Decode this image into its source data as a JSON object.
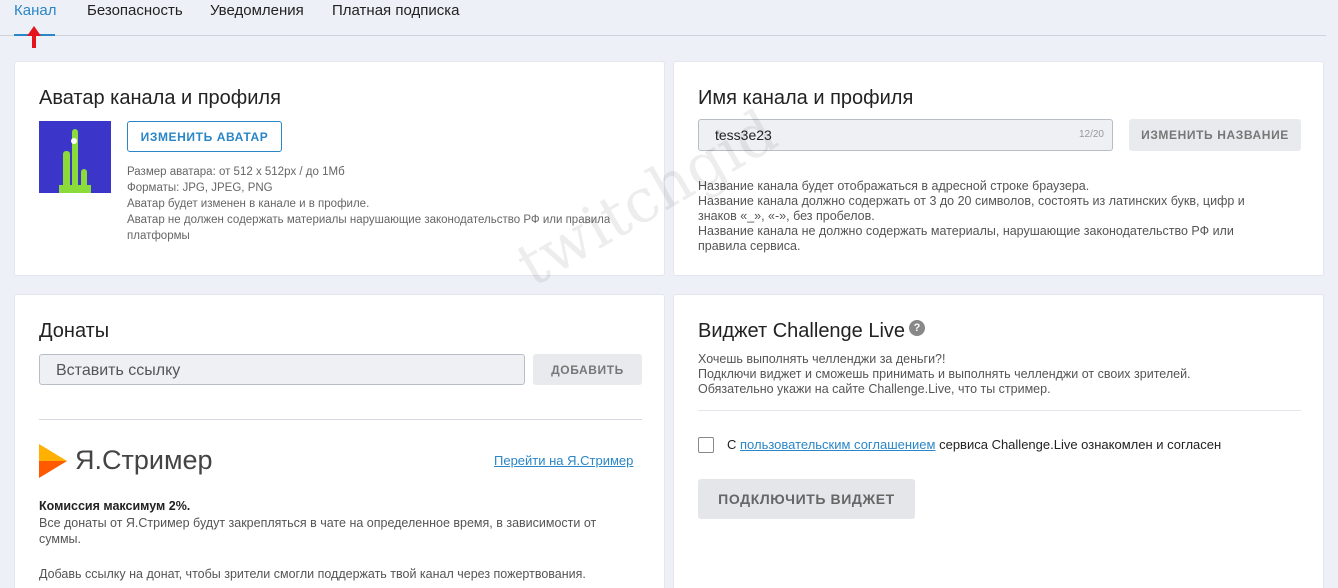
{
  "tabs": [
    "Канал",
    "Безопасность",
    "Уведомления",
    "Платная подписка"
  ],
  "avatar_card": {
    "title": "Аватар канала и профиля",
    "button": "ИЗМЕНИТЬ АВАТАР",
    "info": [
      "Размер аватара: от 512 x 512px / до 1Мб",
      "Форматы: JPG, JPEG, PNG",
      "Аватар будет изменен в канале и в профиле.",
      "Аватар не должен содержать материалы нарушающие законодательство РФ или правила",
      "платформы"
    ]
  },
  "name_card": {
    "title": "Имя канала и профиля",
    "value": "tess3e23",
    "counter": "12/20",
    "button": "ИЗМЕНИТЬ НАЗВАНИЕ",
    "desc": [
      "Название канала будет отображаться в адресной строке браузера.",
      "Название канала должно содержать от 3 до 20 символов, состоять из латинских букв, цифр и",
      "знаков «_», «-», без пробелов.",
      "Название канала не должно содержать материалы, нарушающие законодательство РФ или",
      "правила сервиса."
    ]
  },
  "donations": {
    "title": "Донаты",
    "placeholder": "Вставить ссылку",
    "button": "ДОБАВИТЬ",
    "provider": "Я.Стример",
    "provider_link": "Перейти на Я.Стример",
    "commission": "Комиссия максимум 2%.",
    "desc": [
      "Все донаты от Я.Стример будут закрепляться в чате на определенное время, в зависимости от",
      "суммы."
    ],
    "footer": "Добавь ссылку на донат, чтобы зрители смогли поддержать твой канал через пожертвования."
  },
  "challenge": {
    "title": "Виджет Challenge Live",
    "help": "?",
    "desc": [
      "Хочешь выполнять челленджи за деньги?!",
      "Подключи виджет и сможешь принимать и выполнять челленджи от своих зрителей.",
      "Обязательно укажи на сайте Challenge.Live, что ты стример."
    ],
    "agree_prefix": "С ",
    "agree_link": "пользовательским соглашением",
    "agree_suffix": " сервиса Challenge.Live ознакомлен и согласен",
    "button": "ПОДКЛЮЧИТЬ ВИДЖЕТ"
  },
  "watermark": "twitchgid",
  "colors": {
    "accent": "#2a86c6",
    "arrow": "#e3141b",
    "avatar_bg": "#3b36c9",
    "avatar_fg": "#8bdc3b",
    "ya_orange": "#ff8a00"
  }
}
